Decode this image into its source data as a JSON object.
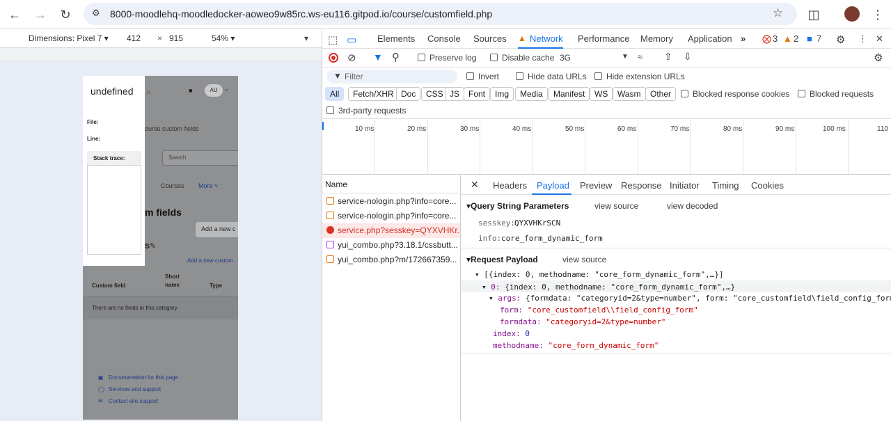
{
  "browser": {
    "url": "8000-moodlehq-moodledocker-aoweo9w85rc.ws-eu116.gitpod.io/course/customfield.php"
  },
  "device_toolbar": {
    "dimensions_label": "Dimensions: Pixel 7 ▾",
    "width": "412",
    "times": "×",
    "height": "915",
    "zoom": "54% ▾"
  },
  "phone": {
    "error_title": "undefined",
    "close": "×",
    "file_label": "File:",
    "line_label": "Line:",
    "stack_label": "Stack trace:",
    "avatar": "AU",
    "breadcrumb": "ourse custom fields",
    "search_placeholder": "Search",
    "nav_courses": "Courses",
    "nav_more": "More ˅",
    "page_heading": "m fields",
    "add_new_button": "Add a new c",
    "category_suffix": "s",
    "add_custom_link": "Add a new custom",
    "table_headers": [
      "Custom field",
      "Short name",
      "Type"
    ],
    "empty_message": "There are no fields in this category",
    "footer_links": [
      "Documentation for this page",
      "Services and support",
      "Contact site support"
    ]
  },
  "devtools": {
    "tabs": [
      "Elements",
      "Console",
      "Sources",
      "Network",
      "Performance",
      "Memory",
      "Application"
    ],
    "active_tab": "Network",
    "errors": "3",
    "warnings": "2",
    "messages": "7",
    "network": {
      "preserve_log": "Preserve log",
      "disable_cache": "Disable cache",
      "throttle": "3G",
      "filter_placeholder": "Filter",
      "invert": "Invert",
      "hide_data_urls": "Hide data URLs",
      "hide_extension_urls": "Hide extension URLs",
      "type_filters": [
        "All",
        "Fetch/XHR",
        "Doc",
        "CSS",
        "JS",
        "Font",
        "Img",
        "Media",
        "Manifest",
        "WS",
        "Wasm",
        "Other"
      ],
      "blocked_response_cookies": "Blocked response cookies",
      "blocked_requests": "Blocked requests",
      "third_party": "3rd-party requests",
      "timeline_ticks": [
        "10 ms",
        "20 ms",
        "30 ms",
        "40 ms",
        "50 ms",
        "60 ms",
        "70 ms",
        "80 ms",
        "90 ms",
        "100 ms",
        "110"
      ],
      "name_header": "Name",
      "requests": [
        {
          "name": "service-nologin.php?info=core...",
          "kind": "xhr",
          "error": false
        },
        {
          "name": "service-nologin.php?info=core...",
          "kind": "xhr",
          "error": false
        },
        {
          "name": "service.php?sesskey=QYXVHKr...",
          "kind": "error",
          "error": true
        },
        {
          "name": "yui_combo.php?3.18.1/cssbutt...",
          "kind": "css",
          "error": false
        },
        {
          "name": "yui_combo.php?m/172667359...",
          "kind": "js",
          "error": false
        }
      ],
      "detail_tabs": [
        "Headers",
        "Payload",
        "Preview",
        "Response",
        "Initiator",
        "Timing",
        "Cookies"
      ],
      "active_detail_tab": "Payload",
      "query_section": "Query String Parameters",
      "view_source": "view source",
      "view_decoded": "view decoded",
      "query_params": [
        {
          "key": "sesskey:",
          "value": "QYXVHKrSCN"
        },
        {
          "key": "info:",
          "value": "core_form_dynamic_form"
        }
      ],
      "payload_section": "Request Payload",
      "payload_view_source": "view source",
      "payload_lines": {
        "root": "[{index: 0, methodname: \"core_form_dynamic_form\",…}]",
        "item_key": "0:",
        "item_val": "{index: 0, methodname: \"core_form_dynamic_form\",…}",
        "args_key": "args:",
        "args_val": "{formdata: \"categoryid=2&type=number\", form: \"core_customfield\\field_config_form",
        "form_key": "form:",
        "form_val": "\"core_customfield\\\\field_config_form\"",
        "formdata_key": "formdata:",
        "formdata_val": "\"categoryid=2&type=number\"",
        "index_key": "index:",
        "index_val": "0",
        "methodname_key": "methodname:",
        "methodname_val": "\"core_form_dynamic_form\""
      }
    }
  },
  "colors": {
    "accent": "#1a73e8",
    "error": "#d93025",
    "warning": "#e37400"
  }
}
